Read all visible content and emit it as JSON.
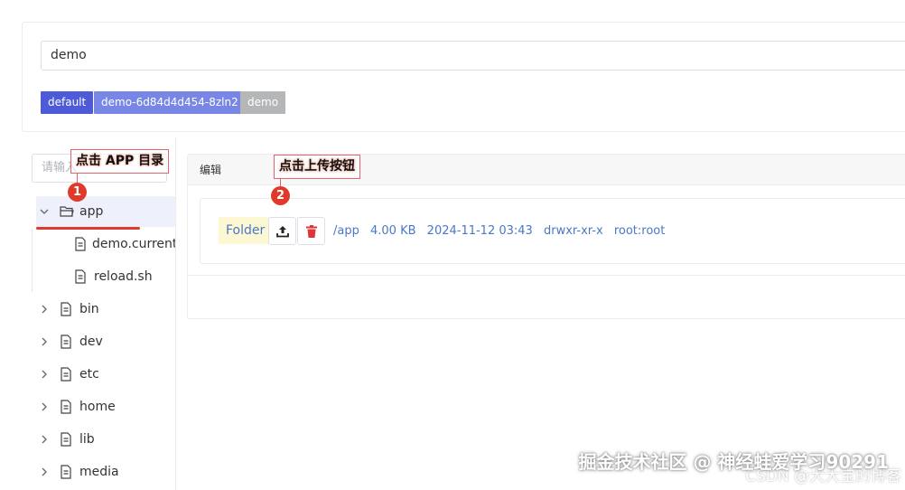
{
  "namespace": {
    "value": "demo"
  },
  "tags": [
    "default",
    "demo-6d84d4d454-8zln2",
    "demo"
  ],
  "tree": {
    "search_placeholder": "请输入",
    "items": [
      {
        "label": "app",
        "type": "folder",
        "expanded": true,
        "selected": true
      },
      {
        "label": "demo.current",
        "type": "file",
        "child": true
      },
      {
        "label": "reload.sh",
        "type": "file",
        "child": true
      },
      {
        "label": "bin",
        "type": "file"
      },
      {
        "label": "dev",
        "type": "file"
      },
      {
        "label": "etc",
        "type": "file"
      },
      {
        "label": "home",
        "type": "file"
      },
      {
        "label": "lib",
        "type": "file"
      },
      {
        "label": "media",
        "type": "file"
      }
    ]
  },
  "annotations": {
    "step1_text": "点击 APP 目录",
    "step2_text": "点击上传按钮",
    "step1_badge": "1",
    "step2_badge": "2"
  },
  "panel": {
    "title": "编辑",
    "file": {
      "kind_label": "Folder",
      "path": "/app",
      "size": "4.00 KB",
      "modified": "2024-11-12 03:43",
      "permissions": "drwxr-xr-x",
      "owner": "root:root"
    }
  },
  "watermark": {
    "main": "掘金技术社区 @ 神经蛙爱学习90291",
    "secondary": "CSDN @大大宝的博客"
  },
  "colors": {
    "tag_primary": "#4d5bd8",
    "tag_secondary": "#7887e6",
    "tag_muted": "#b5b6b8",
    "annotation_red": "#e03a2a",
    "delete_red": "#e0333a",
    "link_blue": "#4a78c8"
  }
}
